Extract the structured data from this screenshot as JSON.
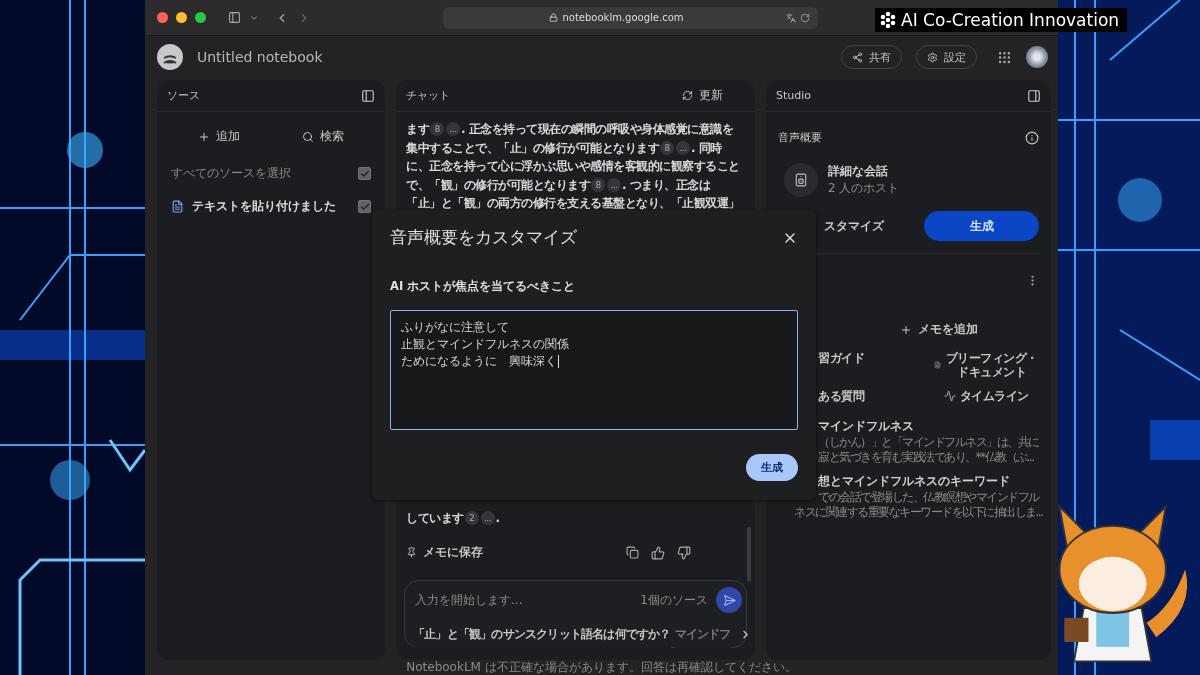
{
  "browser": {
    "url": "notebooklm.google.com"
  },
  "brand": {
    "text": "AI Co-Creation Innovation"
  },
  "header": {
    "title": "Untitled notebook",
    "buttons": [
      {
        "label": "共有",
        "kind": "share"
      },
      {
        "label": "設定",
        "kind": "settings"
      }
    ]
  },
  "sources": {
    "title": "ソース",
    "actions": [
      {
        "label": "追加",
        "kind": "add"
      },
      {
        "label": "検索",
        "kind": "search"
      }
    ],
    "select_all": {
      "label": "すべてのソースを選択",
      "checked": true
    },
    "items": [
      {
        "name": "テキストを貼り付けました",
        "checked": true
      }
    ]
  },
  "chat": {
    "title": "チャット",
    "refresh": "更新",
    "message_top": [
      [
        {
          "kind": "text",
          "text": "ます"
        },
        {
          "kind": "cite",
          "text": "8"
        },
        {
          "kind": "cite",
          "text": "..."
        },
        {
          "kind": "text",
          "text": ". 正念を持って現在の瞬間の呼吸や身体感覚に意識を"
        }
      ],
      [
        {
          "kind": "text",
          "text": "集中することで、「止」の修行が可能となります"
        },
        {
          "kind": "cite",
          "text": "8"
        },
        {
          "kind": "cite",
          "text": "..."
        },
        {
          "kind": "text",
          "text": ". 同時"
        }
      ],
      [
        {
          "kind": "text",
          "text": "に、正念を持って心に浮かぶ思いや感情を客観的に観察すること"
        }
      ],
      [
        {
          "kind": "text",
          "text": "で、「観」の修行が可能となります"
        },
        {
          "kind": "cite",
          "text": "8"
        },
        {
          "kind": "cite",
          "text": "..."
        },
        {
          "kind": "text",
          "text": ". つまり、正念は"
        }
      ],
      [
        {
          "kind": "text",
          "text": "「止」と「観」の両方の修行を支える基盤となり、「止観双運」"
        }
      ]
    ],
    "message_bottom": [
      [
        {
          "kind": "text",
          "text": "しています"
        },
        {
          "kind": "cite",
          "text": "2"
        },
        {
          "kind": "cite",
          "text": "..."
        },
        {
          "kind": "text",
          "text": "."
        }
      ]
    ],
    "save_note": "メモに保存",
    "input": {
      "placeholder": "入力を開始します...",
      "source_count": "1個のソース"
    },
    "suggestions": [
      {
        "text": "「止」と「観」のサンスクリット語名は何ですか？",
        "faded": false
      },
      {
        "text": "マインドフ",
        "faded": true
      }
    ]
  },
  "studio": {
    "title": "Studio",
    "audio": {
      "title": "音声概要",
      "card": {
        "title": "詳細な会話",
        "subtitle": "2 人のホスト"
      },
      "customize": "スタマイズ",
      "generate": "生成"
    },
    "notes": {
      "add": "メモを追加",
      "tools": [
        {
          "label": "習ガイド",
          "kind": "guide"
        },
        {
          "label": "ブリーフィング・ドキュメント",
          "kind": "doc"
        },
        {
          "label": "ある質問",
          "kind": "faq"
        },
        {
          "label": "タイムライン",
          "kind": "timeline"
        }
      ],
      "items": [
        {
          "title": "マインドフルネス",
          "lines": [
            "（しかん）」と「マインドフルネス」は、共に",
            "寂と気づきを育む実践法であり、**仏教（ぶ..."
          ]
        },
        {
          "title": "想とマインドフルネスのキーワード",
          "lines": [
            "での会話で登場した、仏教瞑想やマインドフル",
            "ネスに関連する重要なキーワードを以下に抽出しま..."
          ]
        }
      ]
    }
  },
  "dialog": {
    "title": "音声概要をカスタマイズ",
    "label": "AI ホストが焦点を当てるべきこと",
    "value_lines": [
      "ふりがなに注意して",
      "止観とマインドフルネスの関係",
      "ためになるように　興味深く"
    ],
    "button": "生成"
  },
  "footer": "NotebookLM は不正確な場合があります。回答は再確認してください。"
}
